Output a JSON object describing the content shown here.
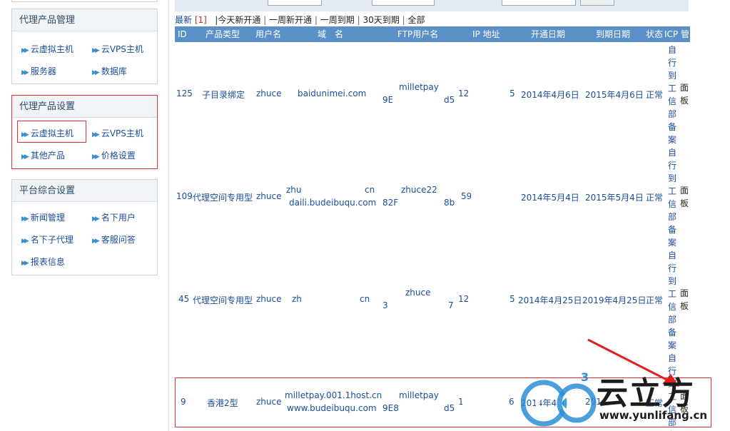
{
  "sidebar": {
    "sections": [
      {
        "title": "代理产品管理",
        "links": [
          "云虚拟主机",
          "云VPS主机",
          "服务器",
          "数据库"
        ]
      },
      {
        "title": "代理产品设置",
        "links": [
          "云虚拟主机",
          "云VPS主机",
          "其他产品",
          "价格设置"
        ]
      },
      {
        "title": "平台综合设置",
        "links": [
          "新闻管理",
          "名下用户",
          "名下子代理",
          "客服问答",
          "报表信息"
        ]
      }
    ]
  },
  "filter": {
    "latest": "最新",
    "latest_count": "[1]",
    "today": "|今天新开通",
    "week_new": "一周新开通",
    "week_expire": "一周到期",
    "month_expire": "30天到期",
    "all": "全部",
    "sep": "|"
  },
  "table": {
    "headers": [
      "ID",
      "产品类型",
      "用户名",
      "域　名",
      "FTP用户名",
      "IP 地址",
      "开通日期",
      "到期日期",
      "状态",
      "ICP 管"
    ],
    "rows": [
      {
        "id": "125",
        "type": "子目录绑定",
        "user": "zhuce",
        "domain1": "baidunimei.com",
        "domain2": "",
        "ftp1": "milletpay",
        "ftp2": "9E",
        "ftp2_end": "d5",
        "ip": "12",
        "ip_end": "5",
        "open": "2014年4月6日",
        "expire": "2015年4月6日",
        "status": "正常",
        "icp": "自行到工信部备案",
        "panel": "面板"
      },
      {
        "id": "109",
        "type": "代理空间专用型",
        "user": "zhuce",
        "domain1": "zhu",
        "domain1_end": "cn",
        "domain2": "daili.budeibuqu.com",
        "ftp1": "zhuce22",
        "ftp2": "82F",
        "ftp2_end": "8b",
        "ip": "59",
        "ip_end": "",
        "open": "2014年5月4日",
        "expire": "2015年5月4日",
        "status": "正常",
        "icp": "自行到工信部备案",
        "panel": "面板"
      },
      {
        "id": "45",
        "type": "代理空间专用型",
        "user": "zhuce",
        "domain1": "zh",
        "domain1_end": "cn",
        "domain2": "",
        "ftp1": "zhuce",
        "ftp2": "3",
        "ftp2_end": "7",
        "ip": "12",
        "ip_end": "5",
        "open": "2014年4月25日",
        "expire": "2019年4月25日",
        "status": "正常",
        "icp": "自行到工信部备案",
        "panel": "面板"
      },
      {
        "id": "9",
        "type": "香港2型",
        "user": "zhuce",
        "domain1": "milletpay.001.1host.cn",
        "domain2": "www.budeibuqu.com",
        "ftp1": "milletpay",
        "ftp2": "9E8",
        "ftp2_end": "d5",
        "ip": "1",
        "ip_end": "6",
        "open": "2014年4月",
        "expire": "201",
        "status": "正常",
        "icp": "自行到工信部备案",
        "panel": "面板"
      }
    ]
  },
  "watermark": {
    "brand": "云立方",
    "url": "www.yunlifang.cn",
    "sup": "3"
  },
  "colors": {
    "accent": "#5a8fc8",
    "link": "#1a4d99",
    "highlight": "#e03030",
    "header_bg": "#f1f4f7"
  }
}
